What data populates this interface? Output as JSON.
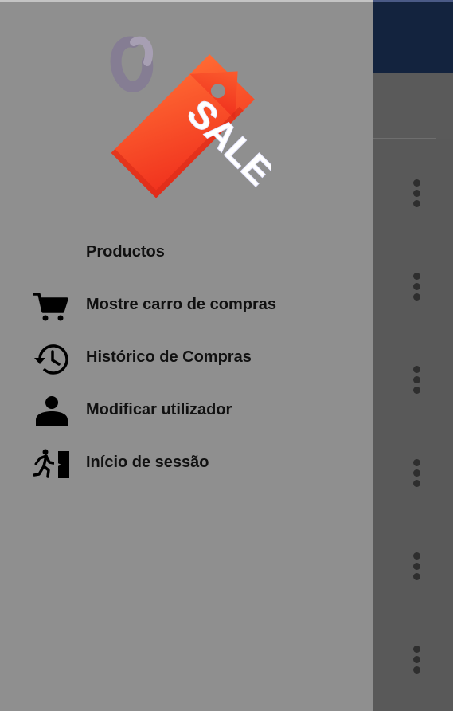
{
  "drawer": {
    "logo_text": "SALE",
    "section_header": "Productos",
    "items": [
      {
        "label": "Mostre carro de compras",
        "icon": "shopping-cart-icon"
      },
      {
        "label": "Histórico de Compras",
        "icon": "history-icon"
      },
      {
        "label": "Modificar utilizador",
        "icon": "person-icon"
      },
      {
        "label": "Início de sessão",
        "icon": "exit-door-icon"
      }
    ]
  },
  "background": {
    "topbar_color": "#13233e",
    "overflow_menu_icon": "more-vert-icon"
  },
  "colors": {
    "drawer_bg": "#8f8f8f",
    "tag_red": "#f23a1f",
    "tag_orange": "#ff5a2a",
    "tag_string": "#8a7f9a"
  }
}
